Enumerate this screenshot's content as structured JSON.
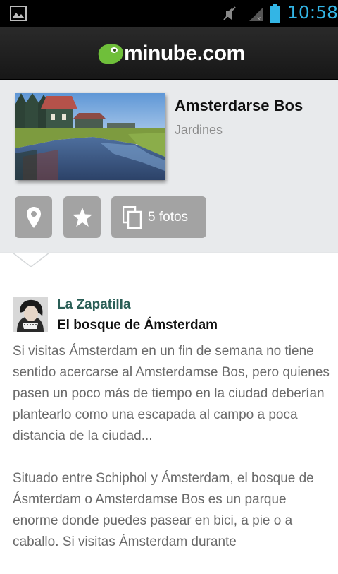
{
  "status_bar": {
    "time": "10:58",
    "icons": [
      "gallery-icon",
      "mute-icon",
      "signal-icon",
      "battery-icon"
    ],
    "accent_color": "#33b5e5"
  },
  "app": {
    "logo_text": "minube.com",
    "logo_color": "#6fbf3a"
  },
  "place": {
    "title": "Amsterdarse Bos",
    "category": "Jardines",
    "photos_label": "5 fotos"
  },
  "review": {
    "author": "La Zapatilla",
    "title": "El bosque de Ámsterdam",
    "paragraphs": [
      "Si visitas Ámsterdam en un fin de semana no tiene sentido acercarse al Amsterdamse Bos, pero quienes pasen un poco más de tiempo en la ciudad deberían plantearlo como una escapada al campo a poca distancia de la ciudad...",
      "Situado entre Schiphol y Ámsterdam, el bosque de Ásmterdam o Amsterdamse Bos es un parque enorme donde puedes pasear en bici, a pie o a caballo. Si visitas Ámsterdam durante"
    ]
  }
}
